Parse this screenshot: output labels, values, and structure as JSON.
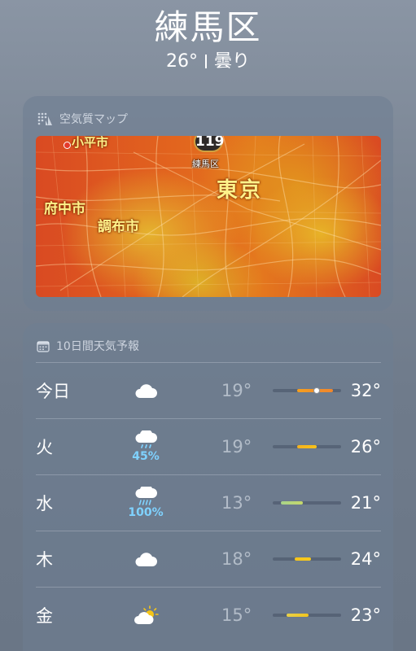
{
  "location": {
    "city": "練馬区",
    "temperature": "26°",
    "condition": "曇り"
  },
  "air_quality": {
    "title": "空気質マップ",
    "aqi_value": "119",
    "aqi_location": "練馬区",
    "map_labels": {
      "kodaira": "小平市",
      "fuchu": "府中市",
      "chofu": "調布市",
      "tokyo": "東京"
    }
  },
  "forecast": {
    "title": "10日間天気予報",
    "temp_range": {
      "min": 10,
      "max": 35
    },
    "days": [
      {
        "day": "今日",
        "icon": "cloud-icon",
        "precip": "",
        "low": "19°",
        "high": "32°",
        "low_val": 19,
        "high_val": 32,
        "current_val": 26,
        "gradient": [
          "#f7a01c",
          "#f0902a",
          "#f2872c"
        ]
      },
      {
        "day": "火",
        "icon": "cloud-rain-icon",
        "precip": "45%",
        "low": "19°",
        "high": "26°",
        "low_val": 19,
        "high_val": 26,
        "gradient": [
          "#f5b21e",
          "#f7c21a"
        ]
      },
      {
        "day": "水",
        "icon": "cloud-heavy-rain-icon",
        "precip": "100%",
        "low": "13°",
        "high": "21°",
        "low_val": 13,
        "high_val": 21,
        "gradient": [
          "#a8d48a",
          "#c6d86a"
        ]
      },
      {
        "day": "木",
        "icon": "cloud-icon",
        "precip": "",
        "low": "18°",
        "high": "24°",
        "low_val": 18,
        "high_val": 24,
        "gradient": [
          "#f5c41c",
          "#f7ca1c"
        ]
      },
      {
        "day": "金",
        "icon": "cloud-sun-icon",
        "precip": "",
        "low": "15°",
        "high": "23°",
        "low_val": 15,
        "high_val": 23,
        "gradient": [
          "#e8d04a",
          "#f2c41c"
        ]
      }
    ]
  },
  "colors": {
    "background": "#7a8594",
    "card": "#6e7d91",
    "precip_text": "#7fd2ff"
  }
}
